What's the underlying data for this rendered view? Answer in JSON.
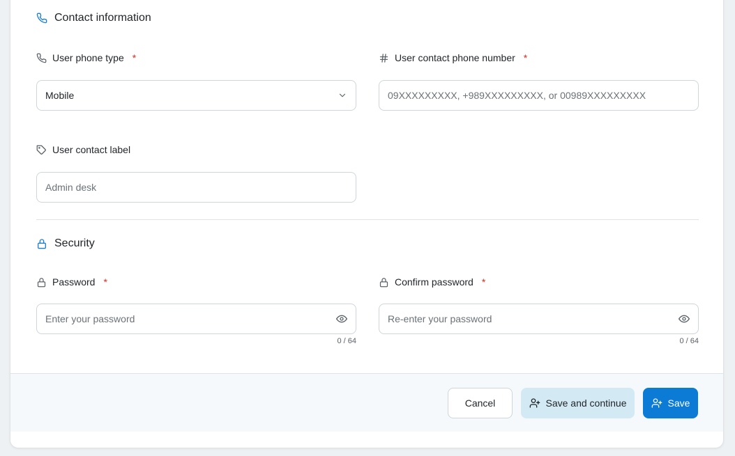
{
  "contact": {
    "title": "Contact information",
    "phone_type": {
      "label": "User phone type",
      "required_mark": "*",
      "value": "Mobile"
    },
    "phone_number": {
      "label": "User contact phone number",
      "required_mark": "*",
      "placeholder": "09XXXXXXXXX, +989XXXXXXXXX, or 00989XXXXXXXXX"
    },
    "contact_label": {
      "label": "User contact label",
      "placeholder": "Admin desk"
    }
  },
  "security": {
    "title": "Security",
    "password": {
      "label": "Password",
      "required_mark": "*",
      "placeholder": "Enter your password",
      "counter": "0 / 64"
    },
    "confirm_password": {
      "label": "Confirm password",
      "required_mark": "*",
      "placeholder": "Re-enter your password",
      "counter": "0 / 64"
    }
  },
  "footer": {
    "cancel_label": "Cancel",
    "save_continue_label": "Save and continue",
    "save_label": "Save"
  },
  "colors": {
    "accent": "#0b7bd6",
    "required": "#d92d20",
    "secondary_button": "#d3eaf5"
  }
}
